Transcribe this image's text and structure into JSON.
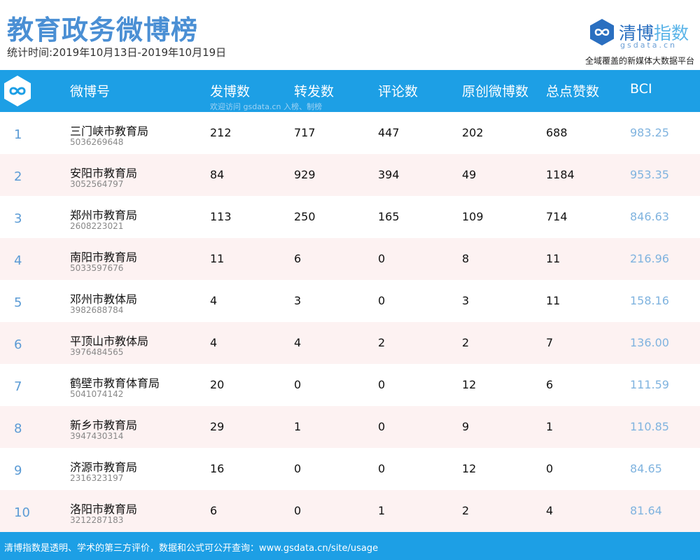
{
  "header": {
    "title": "教育政务微博榜",
    "period": "统计时间:2019年10月13日-2019年10月19日"
  },
  "brand": {
    "name_main": "清博",
    "name_accent": "指数",
    "domain": "gsdata.cn",
    "slogan": "全域覆盖的新媒体大数据平台",
    "logo_icon": "infinity-hexagon-icon"
  },
  "colors": {
    "title": "#4a8fd4",
    "header_bar": "#1d9fe5",
    "row_alt": "#fdf2f2",
    "rank": "#5b9bd5",
    "bci": "#7fb3df"
  },
  "chart_data": {
    "type": "table",
    "columns": [
      "微博号",
      "发博数",
      "转发数",
      "评论数",
      "原创微博数",
      "总点赞数",
      "BCI"
    ],
    "header_note": "欢迎访问 gsdata.cn 入榜、制榜",
    "rows": [
      {
        "rank": "1",
        "name": "三门峡市教育局",
        "id": "5036269648",
        "posts": "212",
        "reposts": "717",
        "comments": "447",
        "original": "202",
        "likes": "688",
        "bci": "983.25"
      },
      {
        "rank": "2",
        "name": "安阳市教育局",
        "id": "3052564797",
        "posts": "84",
        "reposts": "929",
        "comments": "394",
        "original": "49",
        "likes": "1184",
        "bci": "953.35"
      },
      {
        "rank": "3",
        "name": "郑州市教育局",
        "id": "2608223021",
        "posts": "113",
        "reposts": "250",
        "comments": "165",
        "original": "109",
        "likes": "714",
        "bci": "846.63"
      },
      {
        "rank": "4",
        "name": "南阳市教育局",
        "id": "5033597676",
        "posts": "11",
        "reposts": "6",
        "comments": "0",
        "original": "8",
        "likes": "11",
        "bci": "216.96"
      },
      {
        "rank": "5",
        "name": "邓州市教体局",
        "id": "3982688784",
        "posts": "4",
        "reposts": "3",
        "comments": "0",
        "original": "3",
        "likes": "11",
        "bci": "158.16"
      },
      {
        "rank": "6",
        "name": "平顶山市教体局",
        "id": "3976484565",
        "posts": "4",
        "reposts": "4",
        "comments": "2",
        "original": "2",
        "likes": "7",
        "bci": "136.00"
      },
      {
        "rank": "7",
        "name": "鹤壁市教育体育局",
        "id": "5041074142",
        "posts": "20",
        "reposts": "0",
        "comments": "0",
        "original": "12",
        "likes": "6",
        "bci": "111.59"
      },
      {
        "rank": "8",
        "name": "新乡市教育局",
        "id": "3947430314",
        "posts": "29",
        "reposts": "1",
        "comments": "0",
        "original": "9",
        "likes": "1",
        "bci": "110.85"
      },
      {
        "rank": "9",
        "name": "济源市教育局",
        "id": "2316323197",
        "posts": "16",
        "reposts": "0",
        "comments": "0",
        "original": "12",
        "likes": "0",
        "bci": "84.65"
      },
      {
        "rank": "10",
        "name": "洛阳市教育局",
        "id": "3212287183",
        "posts": "6",
        "reposts": "0",
        "comments": "1",
        "original": "2",
        "likes": "4",
        "bci": "81.64"
      }
    ]
  },
  "footer": {
    "text": "清博指数是透明、学术的第三方评价，数据和公式可公开查询：www.gsdata.cn/site/usage"
  }
}
